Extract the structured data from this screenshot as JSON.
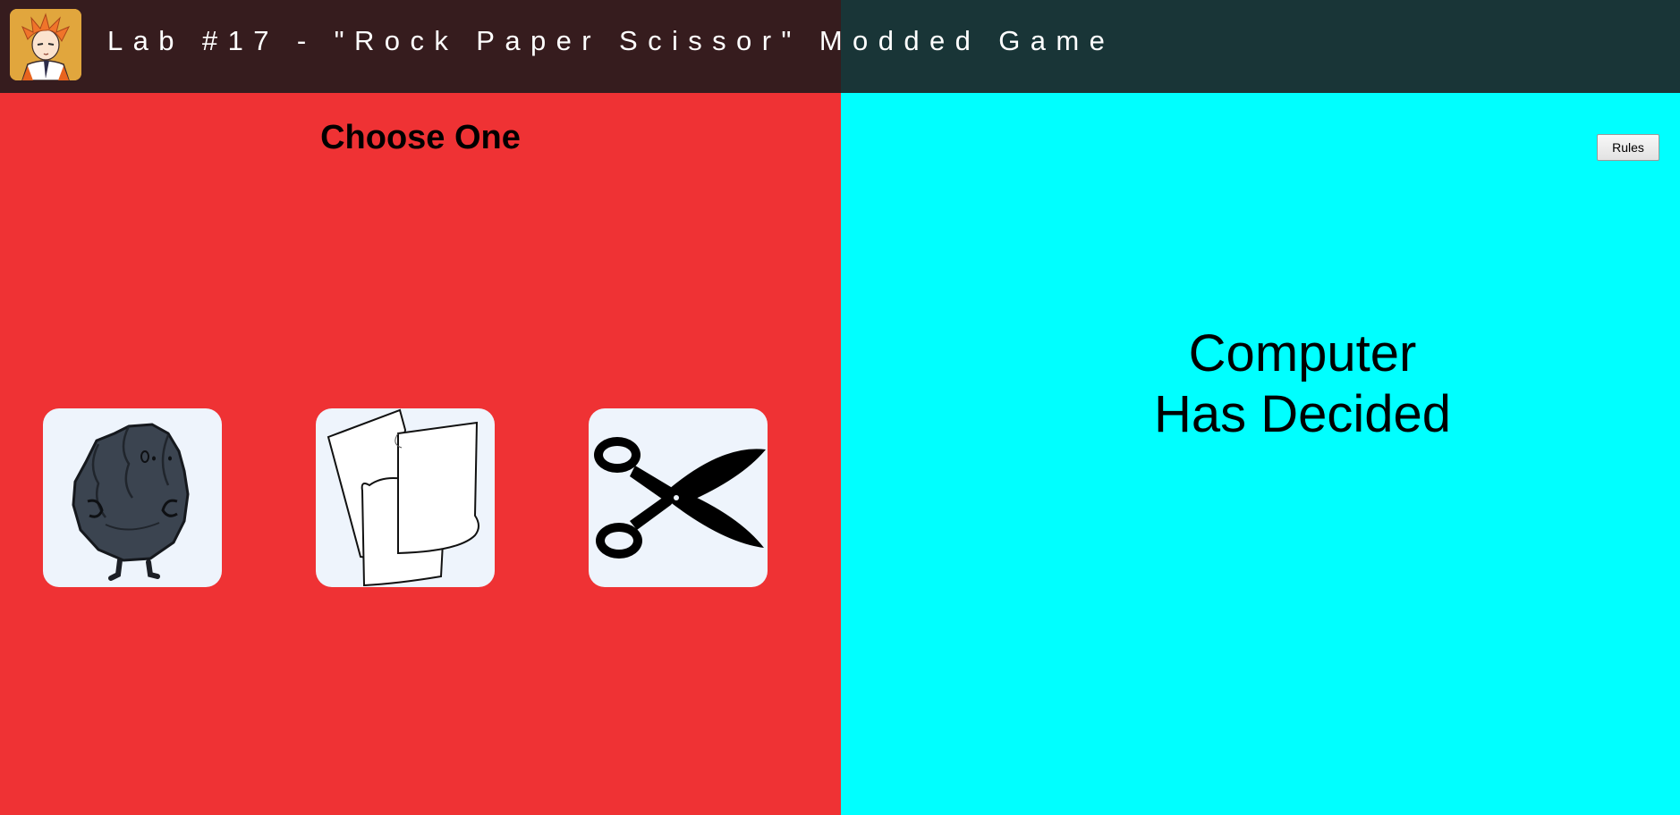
{
  "header": {
    "title": "Lab #17 - \"Rock Paper Scissor\" Modded Game",
    "avatar_icon": "anime-character-avatar"
  },
  "player_panel": {
    "heading": "Choose One",
    "choices": [
      {
        "name": "Rock",
        "icon": "rock-character-icon"
      },
      {
        "name": "Paper",
        "icon": "paper-sheets-icon"
      },
      {
        "name": "Scissors",
        "icon": "scissors-icon"
      }
    ]
  },
  "computer_panel": {
    "rules_label": "Rules",
    "status_line1": "Computer",
    "status_line2": "Has Decided"
  },
  "colors": {
    "player_panel_bg": "#ef3234",
    "computer_panel_bg": "#00ffff",
    "header_left_bg": "#361c1e",
    "header_right_bg": "#193537",
    "choice_card_bg": "#eef4fc",
    "avatar_bg": "#e1a63d"
  }
}
